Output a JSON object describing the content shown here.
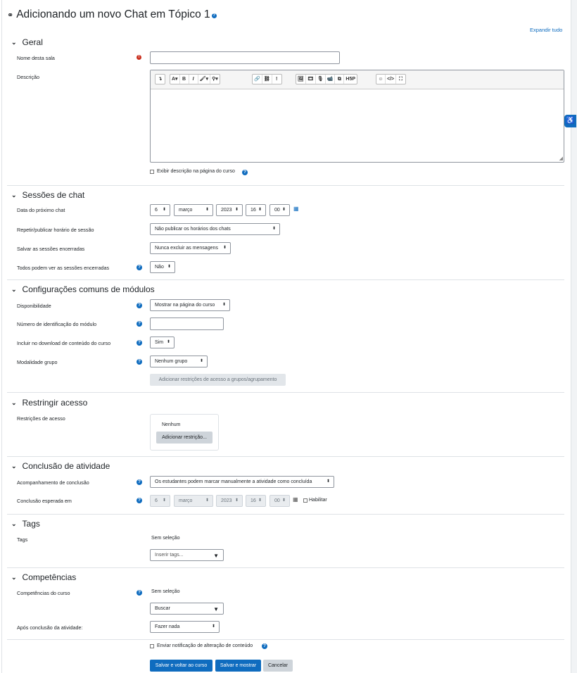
{
  "page": {
    "title": "Adicionando um novo Chat em Tópico 1",
    "expand_all": "Expandir tudo"
  },
  "colors": {
    "primary": "#0f6cbf",
    "required": "#ca3120",
    "secondary_button": "#ced4da"
  },
  "geral": {
    "heading": "Geral",
    "name_label": "Nome desta sala",
    "name_value": "",
    "description_label": "Descrição",
    "toolbar": [
      "↴",
      "A▾",
      "B",
      "I",
      "🖌▾",
      "⚲▾",
      "🔗",
      "⛓",
      "!",
      "🖼",
      "🎞",
      "🎙",
      "📹",
      "⧉",
      "H5P",
      "☺",
      "</>",
      "⛶"
    ],
    "show_description": "Exibir descrição na página do curso"
  },
  "sessions": {
    "heading": "Sessões de chat",
    "next_chat_label": "Data do próximo chat",
    "day": "6",
    "month": "março",
    "year": "2023",
    "hour": "16",
    "minute": "00",
    "repeat_label": "Repetir/publicar horário de sessão",
    "repeat_value": "Não publicar os horários dos chats",
    "save_label": "Salvar as sessões encerradas",
    "save_value": "Nunca excluir as mensagens",
    "everyone_label": "Todos podem ver as sessões encerradas",
    "everyone_value": "Não"
  },
  "common": {
    "heading": "Configurações comuns de módulos",
    "availability_label": "Disponibilidade",
    "availability_value": "Mostrar na página do curso",
    "idnumber_label": "Número de identificação do módulo",
    "idnumber_value": "",
    "download_label": "Incluir no download de conteúdo do curso",
    "download_value": "Sim",
    "groupmode_label": "Modalidade grupo",
    "groupmode_value": "Nenhum grupo",
    "restrict_groups_button": "Adicionar restrições de acesso a grupos/agrupamento"
  },
  "restrict": {
    "heading": "Restringir acesso",
    "label": "Restrições de acesso",
    "none": "Nenhum",
    "add_button": "Adicionar restrição..."
  },
  "completion": {
    "heading": "Conclusão de atividade",
    "tracking_label": "Acompanhamento de conclusão",
    "tracking_value": "Os estudantes podem marcar manualmente a atividade como concluída",
    "expected_label": "Conclusão esperada em",
    "day": "6",
    "month": "março",
    "year": "2023",
    "hour": "16",
    "minute": "00",
    "enable": "Habilitar"
  },
  "tags": {
    "heading": "Tags",
    "label": "Tags",
    "none": "Sem seleção",
    "placeholder": "Inserir tags..."
  },
  "competencies": {
    "heading": "Competências",
    "course_label": "Competências do curso",
    "none": "Sem seleção",
    "search": "Buscar",
    "after_label": "Após conclusão da atividade:",
    "after_value": "Fazer nada"
  },
  "footer": {
    "notify": "Enviar notificação de alteração de conteúdo",
    "save_return": "Salvar e voltar ao curso",
    "save_display": "Salvar e mostrar",
    "cancel": "Cancelar"
  }
}
